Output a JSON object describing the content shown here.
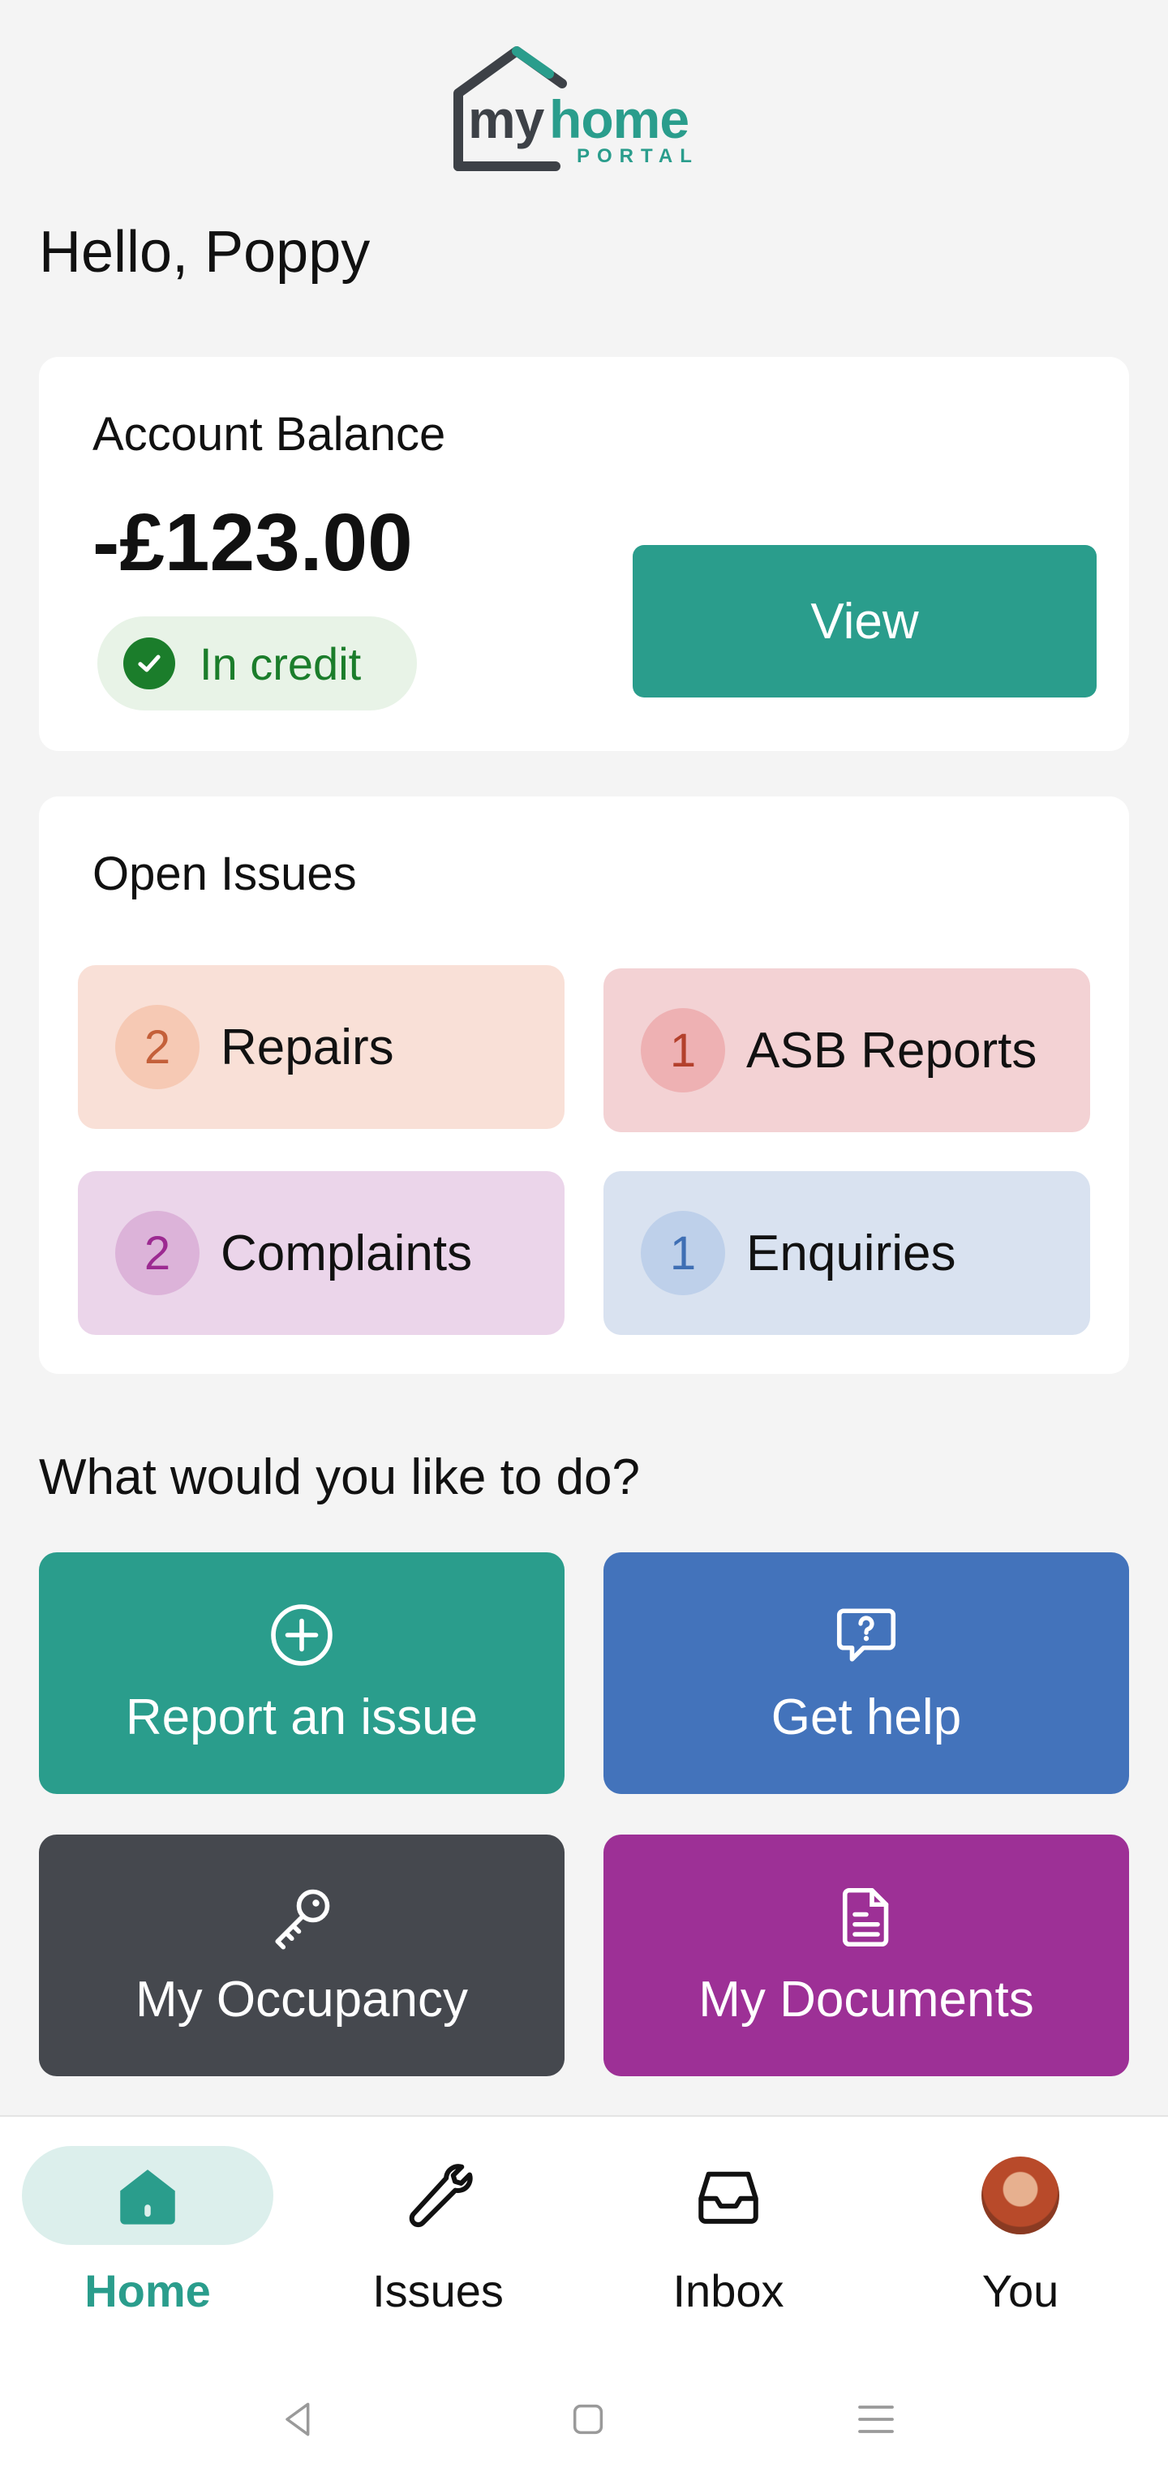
{
  "logo": {
    "my": "my",
    "home": "home",
    "portal": "PORTAL"
  },
  "greeting": "Hello, Poppy",
  "balance": {
    "title": "Account Balance",
    "amount": "-£123.00",
    "status": "In credit",
    "status_icon": "check-circle-icon",
    "view_label": "View"
  },
  "issues": {
    "title": "Open Issues",
    "items": [
      {
        "count": "2",
        "label": "Repairs"
      },
      {
        "count": "1",
        "label": "ASB Reports"
      },
      {
        "count": "2",
        "label": "Complaints"
      },
      {
        "count": "1",
        "label": "Enquiries"
      }
    ]
  },
  "actions": {
    "heading": "What would you like to do?",
    "items": [
      {
        "label": "Report an issue",
        "icon": "plus-circle-icon"
      },
      {
        "label": "Get help",
        "icon": "question-bubble-icon"
      },
      {
        "label": "My Occupancy",
        "icon": "key-icon"
      },
      {
        "label": "My Documents",
        "icon": "document-icon"
      }
    ]
  },
  "nav": {
    "items": [
      {
        "label": "Home",
        "icon": "home-icon",
        "active": true
      },
      {
        "label": "Issues",
        "icon": "wrench-icon"
      },
      {
        "label": "Inbox",
        "icon": "inbox-icon"
      },
      {
        "label": "You",
        "icon": "avatar"
      }
    ]
  },
  "colors": {
    "brand_teal": "#2a9d8c",
    "help_blue": "#4373bb",
    "occupancy_gray": "#45484e",
    "documents_purple": "#9d3096",
    "credit_green": "#1b7d2b"
  }
}
